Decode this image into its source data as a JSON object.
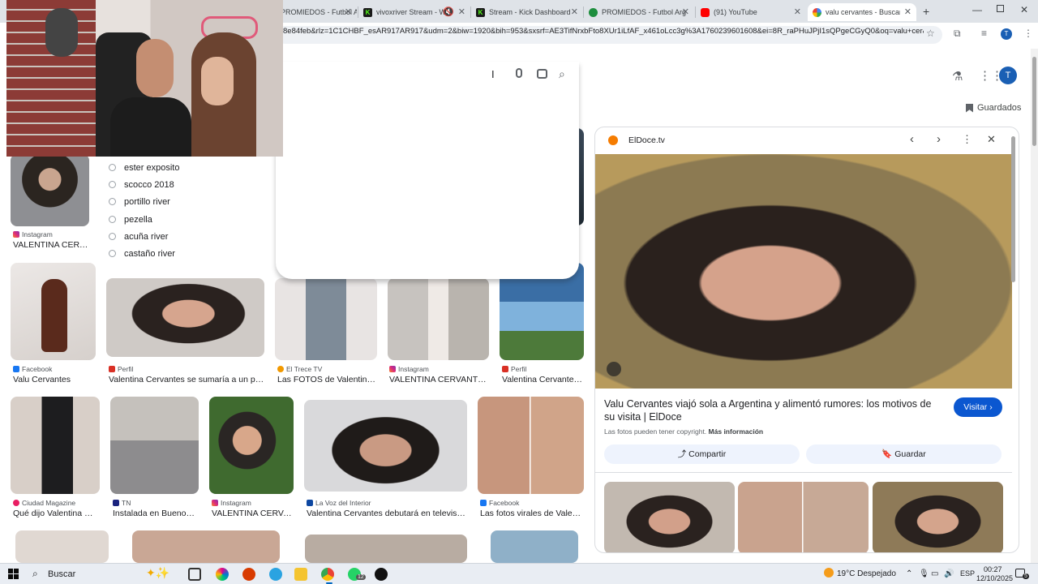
{
  "browser": {
    "tabs": [
      {
        "title": "PROMIEDOS - Futbol Arg"
      },
      {
        "title": "vivoxriver Stream - W"
      },
      {
        "title": "Stream - Kick Dashboard"
      },
      {
        "title": "PROMIEDOS - Futbol Arg"
      },
      {
        "title": "(91) YouTube"
      },
      {
        "title": "valu cervantes - Buscar c"
      }
    ],
    "url": "8e84feb&rlz=1C1CHBF_esAR917AR917&udm=2&biw=1920&bih=953&sxsrf=AE3TifNrxbFto8XUr1iLfAF_x461oLcc3g%3A1760239601608&ei=8R_raPHuJPjI1sQPgeCGyQ0&oq=valu+cer&gs_...",
    "profile_initial": "T"
  },
  "google": {
    "saved_label": "Guardados",
    "account_initial": "T",
    "suggestions": [
      "ester exposito",
      "scocco 2018",
      "portillo river",
      "pezella",
      "acuña river",
      "castaño river"
    ]
  },
  "results": [
    {
      "source": "Instagram",
      "caption": "VALENTINA CERV..."
    },
    {
      "source": "Facebook",
      "caption": "Valu Cervantes"
    },
    {
      "source": "Perfil",
      "caption": "Valentina Cervantes se sumaría a un prog..."
    },
    {
      "source": "El Trece TV",
      "caption": "Las FOTOS de Valentina ..."
    },
    {
      "source": "Instagram",
      "caption": "VALENTINA CERVANTE..."
    },
    {
      "source": "Perfil",
      "caption": "Valentina Cervantes ..."
    },
    {
      "source": "Ciudad Magazine",
      "caption": "Qué dijo Valentina Ce..."
    },
    {
      "source": "TN",
      "caption": "Instalada en Buenos ..."
    },
    {
      "source": "Instagram",
      "caption": "VALENTINA CERVA..."
    },
    {
      "source": "La Voz del Interior",
      "caption": "Valentina Cervantes debutará en televisión ..."
    },
    {
      "source": "Facebook",
      "caption": "Las fotos virales de Valenti..."
    }
  ],
  "panel": {
    "site": "ElDoce.tv",
    "title": "Valu Cervantes viajó sola a Argentina y alimentó rumores: los motivos de su visita | ElDoce",
    "visit_label": "Visitar",
    "copyright_text": "Las fotos pueden tener copyright.",
    "more_info": "Más información",
    "share_label": "Compartir",
    "save_label": "Guardar"
  },
  "taskbar": {
    "search_label": "Buscar",
    "weather": "19°C  Despejado",
    "lang": "ESP",
    "time": "00:27",
    "date": "12/10/2025",
    "whatsapp_badge": "12",
    "notif_badge": "5"
  },
  "colors": {
    "google_blue": "#0b57d0",
    "avatar_blue": "#1a5fb4",
    "tab_bg": "#dfe3e8"
  }
}
